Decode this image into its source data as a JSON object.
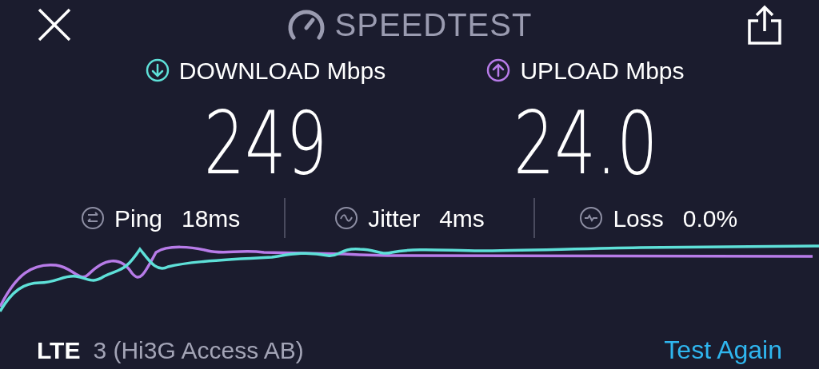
{
  "header": {
    "title": "SPEEDTEST"
  },
  "results": [
    {
      "kind": "download",
      "label": "DOWNLOAD Mbps",
      "value": "249",
      "color": "#5ee0d8"
    },
    {
      "kind": "upload",
      "label": "UPLOAD Mbps",
      "value": "24.0",
      "color": "#b77be8"
    }
  ],
  "metrics": [
    {
      "kind": "ping",
      "label": "Ping",
      "value": "18ms"
    },
    {
      "kind": "jitter",
      "label": "Jitter",
      "value": "4ms"
    },
    {
      "kind": "loss",
      "label": "Loss",
      "value": "0.0%"
    }
  ],
  "footer": {
    "network_type": "LTE",
    "carrier": "3 (Hi3G Access AB)",
    "action": "Test Again"
  }
}
